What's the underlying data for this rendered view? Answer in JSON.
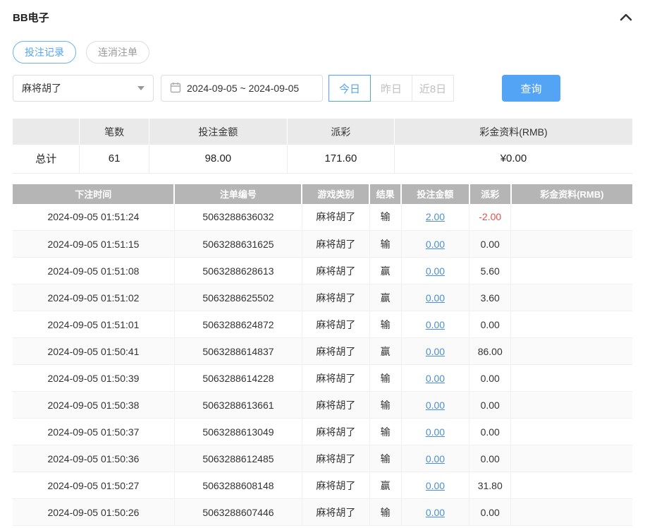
{
  "header": {
    "title": "BB电子",
    "collapse_icon": "chevron-up-icon"
  },
  "tabs": [
    {
      "label": "投注记录",
      "active": true
    },
    {
      "label": "连消注单",
      "active": false
    }
  ],
  "filters": {
    "game_select_value": "麻将胡了",
    "date_range_value": "2024-09-05 ~ 2024-09-05",
    "quick_buttons": [
      {
        "label": "今日",
        "active": true
      },
      {
        "label": "昨日",
        "active": false
      },
      {
        "label": "近8日",
        "active": false
      }
    ],
    "search_label": "查询"
  },
  "summary": {
    "headers": [
      "",
      "笔数",
      "投注金额",
      "派彩",
      "彩金资料(RMB)"
    ],
    "row_label": "总计",
    "count": "61",
    "bet_amount": "98.00",
    "payout": "171.60",
    "bonus": "¥0.00"
  },
  "table": {
    "headers": [
      "下注时间",
      "注单编号",
      "游戏类别",
      "结果",
      "投注金额",
      "派彩",
      "彩金资料(RMB)"
    ],
    "rows": [
      {
        "time": "2024-09-05 01:51:24",
        "order_id": "5063288636032",
        "game": "麻将胡了",
        "result": "输",
        "bet": "2.00",
        "payout": "-2.00",
        "bonus": ""
      },
      {
        "time": "2024-09-05 01:51:15",
        "order_id": "5063288631625",
        "game": "麻将胡了",
        "result": "输",
        "bet": "0.00",
        "payout": "0.00",
        "bonus": ""
      },
      {
        "time": "2024-09-05 01:51:08",
        "order_id": "5063288628613",
        "game": "麻将胡了",
        "result": "赢",
        "bet": "0.00",
        "payout": "5.60",
        "bonus": ""
      },
      {
        "time": "2024-09-05 01:51:02",
        "order_id": "5063288625502",
        "game": "麻将胡了",
        "result": "赢",
        "bet": "0.00",
        "payout": "3.60",
        "bonus": ""
      },
      {
        "time": "2024-09-05 01:51:01",
        "order_id": "5063288624872",
        "game": "麻将胡了",
        "result": "输",
        "bet": "0.00",
        "payout": "0.00",
        "bonus": ""
      },
      {
        "time": "2024-09-05 01:50:41",
        "order_id": "5063288614837",
        "game": "麻将胡了",
        "result": "赢",
        "bet": "0.00",
        "payout": "86.00",
        "bonus": ""
      },
      {
        "time": "2024-09-05 01:50:39",
        "order_id": "5063288614228",
        "game": "麻将胡了",
        "result": "输",
        "bet": "0.00",
        "payout": "0.00",
        "bonus": ""
      },
      {
        "time": "2024-09-05 01:50:38",
        "order_id": "5063288613661",
        "game": "麻将胡了",
        "result": "输",
        "bet": "0.00",
        "payout": "0.00",
        "bonus": ""
      },
      {
        "time": "2024-09-05 01:50:37",
        "order_id": "5063288613049",
        "game": "麻将胡了",
        "result": "输",
        "bet": "0.00",
        "payout": "0.00",
        "bonus": ""
      },
      {
        "time": "2024-09-05 01:50:36",
        "order_id": "5063288612485",
        "game": "麻将胡了",
        "result": "输",
        "bet": "0.00",
        "payout": "0.00",
        "bonus": ""
      },
      {
        "time": "2024-09-05 01:50:27",
        "order_id": "5063288608148",
        "game": "麻将胡了",
        "result": "赢",
        "bet": "0.00",
        "payout": "31.80",
        "bonus": ""
      },
      {
        "time": "2024-09-05 01:50:26",
        "order_id": "5063288607446",
        "game": "麻将胡了",
        "result": "输",
        "bet": "0.00",
        "payout": "0.00",
        "bonus": ""
      }
    ]
  },
  "colors": {
    "accent": "#54a4f5",
    "link": "#4a90d2",
    "negative": "#e0504a",
    "table_header_bg": "#b5b5b5",
    "summary_header_bg": "#eaeaea"
  }
}
